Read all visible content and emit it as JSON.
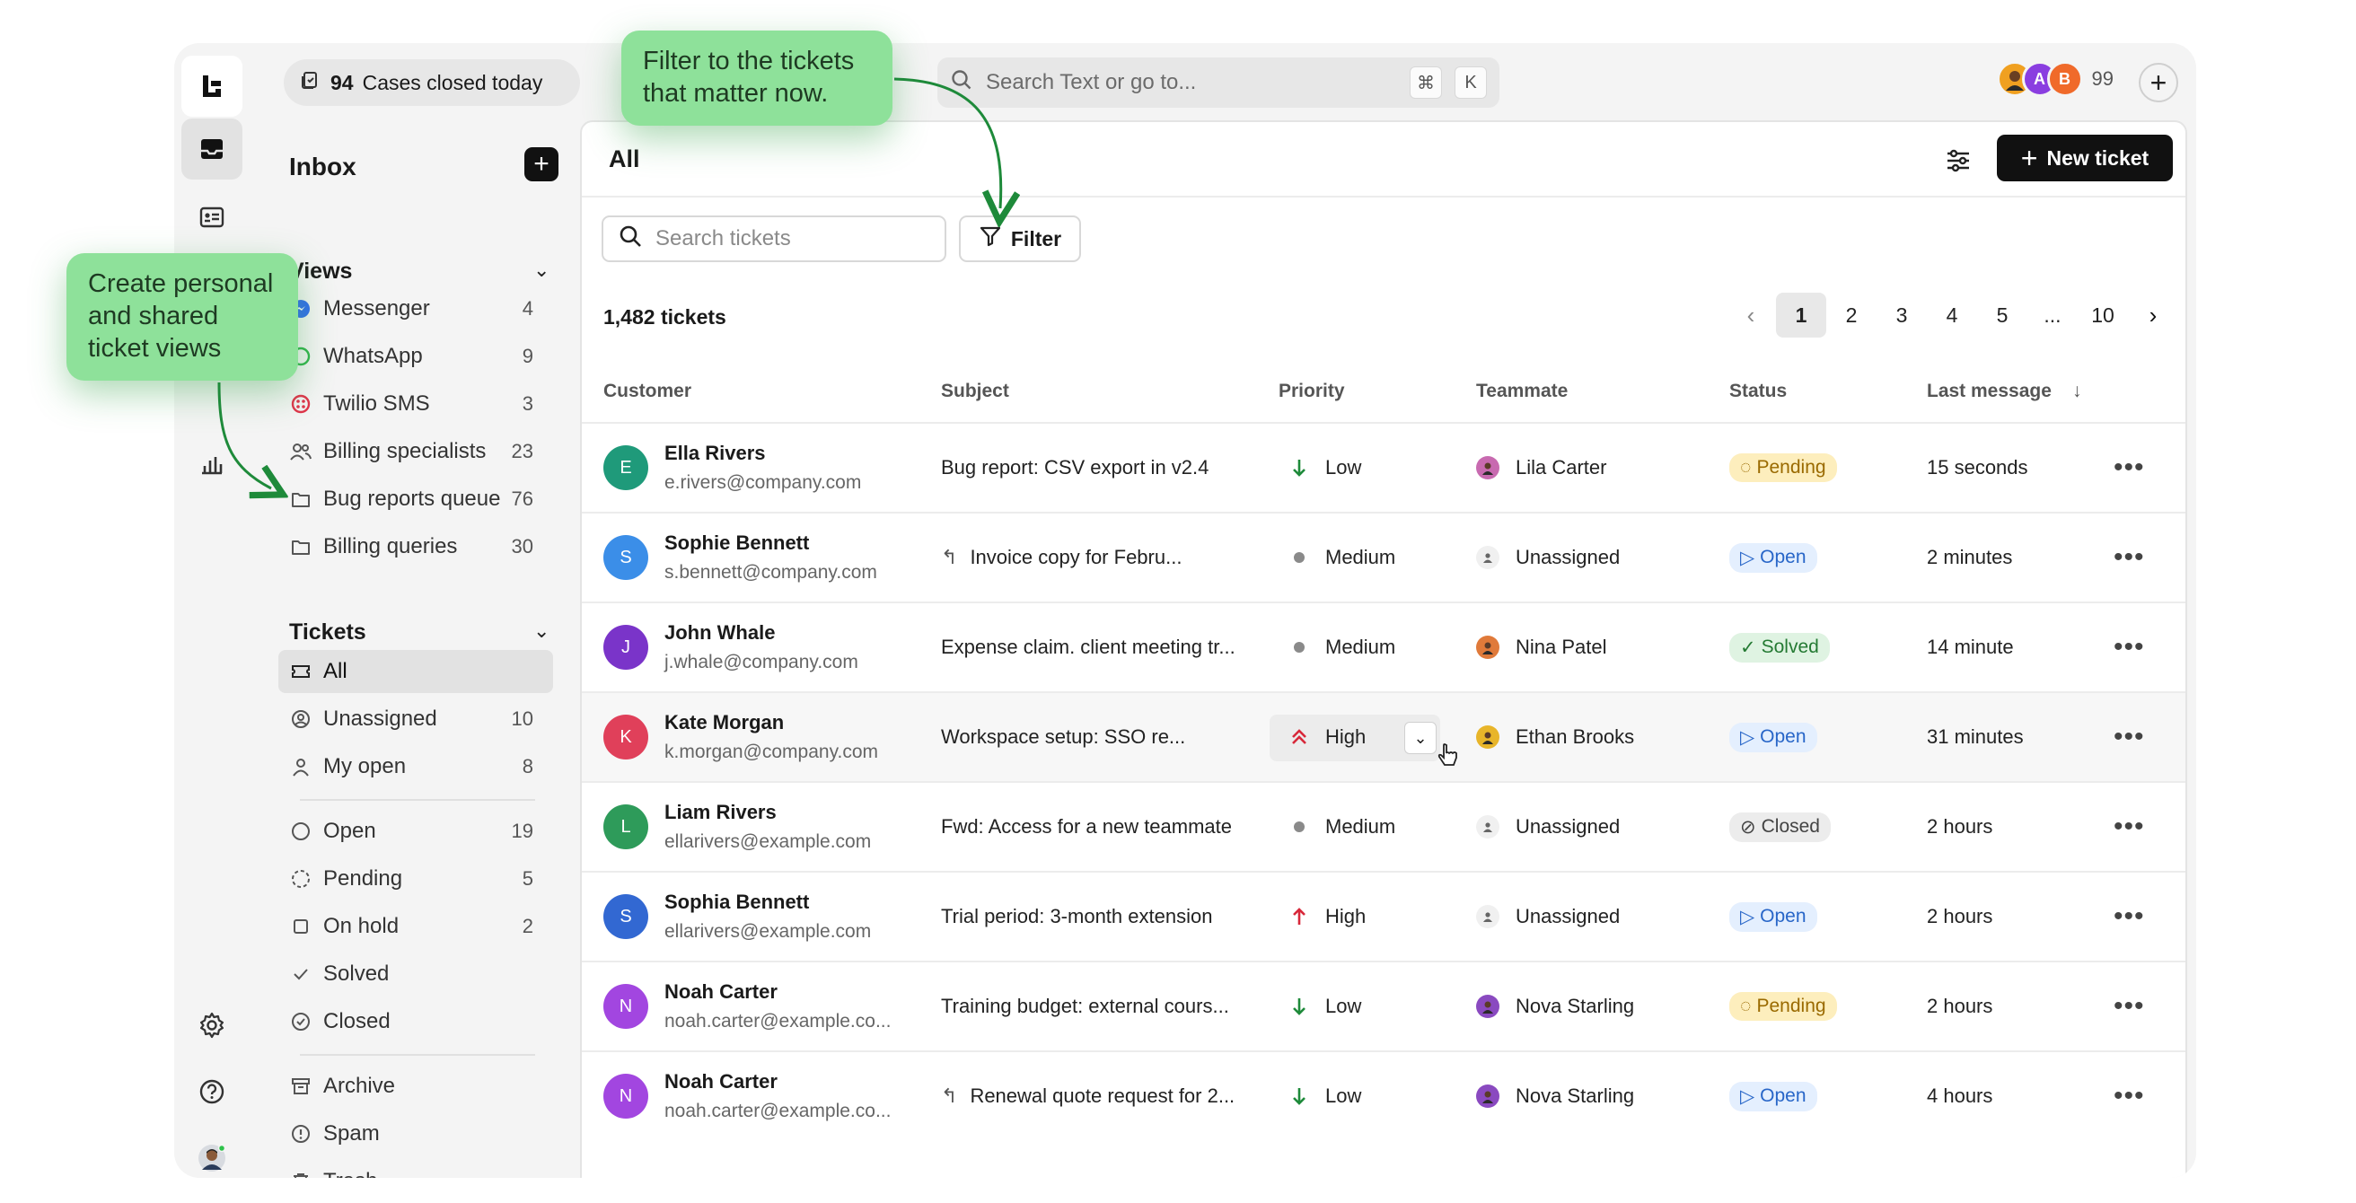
{
  "topbar": {
    "cases_count": "94",
    "cases_label": "Cases closed today",
    "search_placeholder": "Search Text or go to...",
    "shortcut_key1": "⌘",
    "shortcut_key2": "K",
    "avatar_initials": [
      "A",
      "B"
    ],
    "avatar_count": "99",
    "plus_symbol": "+"
  },
  "callouts": {
    "filter_hint": "Filter to the tickets that matter now.",
    "views_hint": "Create personal and shared ticket views"
  },
  "sidebar": {
    "title": "Inbox",
    "add_symbol": "+",
    "views_heading": "Views",
    "views": [
      {
        "label": "Messenger",
        "count": "4",
        "icon": "messenger-icon"
      },
      {
        "label": "WhatsApp",
        "count": "9",
        "icon": "whatsapp-icon"
      },
      {
        "label": "Twilio SMS",
        "count": "3",
        "icon": "twilio-icon"
      },
      {
        "label": "Billing specialists",
        "count": "23",
        "icon": "team-icon"
      },
      {
        "label": "Bug reports queue",
        "count": "76",
        "icon": "folder-icon"
      },
      {
        "label": "Billing queries",
        "count": "30",
        "icon": "folder-icon"
      }
    ],
    "tickets_heading": "Tickets",
    "tickets": [
      {
        "label": "All",
        "count": "",
        "icon": "ticket-icon"
      },
      {
        "label": "Unassigned",
        "count": "10",
        "icon": "user-circle-icon"
      },
      {
        "label": "My open",
        "count": "8",
        "icon": "user-icon"
      }
    ],
    "statuses": [
      {
        "label": "Open",
        "count": "19",
        "icon": "open-circle-icon"
      },
      {
        "label": "Pending",
        "count": "5",
        "icon": "pending-icon"
      },
      {
        "label": "On hold",
        "count": "2",
        "icon": "square-icon"
      },
      {
        "label": "Solved",
        "count": "",
        "icon": "check-icon"
      },
      {
        "label": "Closed",
        "count": "",
        "icon": "closed-icon"
      }
    ],
    "other": [
      {
        "label": "Archive",
        "icon": "archive-icon"
      },
      {
        "label": "Spam",
        "icon": "spam-icon"
      },
      {
        "label": "Trash",
        "icon": "trash-icon"
      }
    ]
  },
  "main": {
    "title": "All",
    "new_ticket_label": "New ticket",
    "search_placeholder": "Search tickets",
    "filter_label": "Filter",
    "ticket_count": "1,482 tickets",
    "pagination": [
      "1",
      "2",
      "3",
      "4",
      "5",
      "...",
      "10"
    ],
    "columns": {
      "customer": "Customer",
      "subject": "Subject",
      "priority": "Priority",
      "teammate": "Teammate",
      "status": "Status",
      "last_message": "Last message"
    },
    "sort_indicator": "↓",
    "rows": [
      {
        "initial": "E",
        "name": "Ella Rivers",
        "email": "e.rivers@company.com",
        "subject": "Bug report: CSV export in v2.4",
        "reply": false,
        "priority": "Low",
        "teammate": "Lila Carter",
        "status": "Pending",
        "last": "15 seconds",
        "av_color": "#1f9a7a"
      },
      {
        "initial": "S",
        "name": "Sophie Bennett",
        "email": "s.bennett@company.com",
        "subject": "Invoice copy for Febru...",
        "reply": true,
        "priority": "Medium",
        "teammate": "Unassigned",
        "status": "Open",
        "last": "2 minutes",
        "av_color": "#3b8ee8"
      },
      {
        "initial": "J",
        "name": "John Whale",
        "email": "j.whale@company.com",
        "subject": "Expense claim. client meeting tr...",
        "reply": false,
        "priority": "Medium",
        "teammate": "Nina Patel",
        "status": "Solved",
        "last": "14 minute",
        "av_color": "#7a34c9"
      },
      {
        "initial": "K",
        "name": "Kate Morgan",
        "email": "k.morgan@company.com",
        "subject": "Workspace setup: SSO re...",
        "reply": false,
        "priority": "High",
        "teammate": "Ethan Brooks",
        "status": "Open",
        "last": "31 minutes",
        "av_color": "#e0405a"
      },
      {
        "initial": "L",
        "name": "Liam Rivers",
        "email": "ellarivers@example.com",
        "subject": "Fwd: Access for a new teammate",
        "reply": false,
        "priority": "Medium",
        "teammate": "Unassigned",
        "status": "Closed",
        "last": "2 hours",
        "av_color": "#2e9b5a"
      },
      {
        "initial": "S",
        "name": "Sophia Bennett",
        "email": "ellarivers@example.com",
        "subject": "Trial period: 3-month extension",
        "reply": false,
        "priority": "High",
        "teammate": "Unassigned",
        "status": "Open",
        "last": "2 hours",
        "av_color": "#3268d2"
      },
      {
        "initial": "N",
        "name": "Noah Carter",
        "email": "noah.carter@example.co...",
        "subject": "Training budget: external cours...",
        "reply": false,
        "priority": "Low",
        "teammate": "Nova Starling",
        "status": "Pending",
        "last": "2 hours",
        "av_color": "#a246e0"
      },
      {
        "initial": "N",
        "name": "Noah Carter",
        "email": "noah.carter@example.co...",
        "subject": "Renewal quote request for 2...",
        "reply": true,
        "priority": "Low",
        "teammate": "Nova Starling",
        "status": "Open",
        "last": "4 hours",
        "av_color": "#a246e0"
      }
    ]
  }
}
